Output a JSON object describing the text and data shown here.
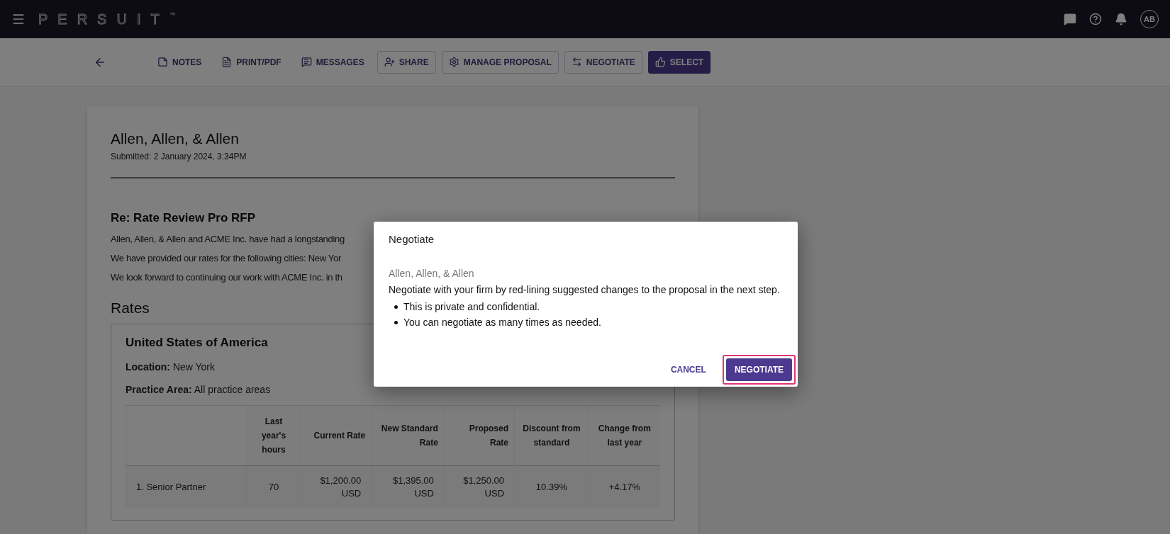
{
  "topbar": {
    "logo": "PERSUIT",
    "logo_mark": "™",
    "avatar": "AB"
  },
  "toolbar": {
    "buttons": [
      {
        "label": "NOTES",
        "kind": "text"
      },
      {
        "label": "PRINT/PDF",
        "kind": "text"
      },
      {
        "label": "MESSAGES",
        "kind": "text"
      },
      {
        "label": "SHARE",
        "kind": "outlined"
      },
      {
        "label": "MANAGE PROPOSAL",
        "kind": "outlined"
      },
      {
        "label": "NEGOTIATE",
        "kind": "outlined"
      },
      {
        "label": "SELECT",
        "kind": "contained"
      }
    ]
  },
  "proposal": {
    "firm": "Allen, Allen, & Allen",
    "submitted": "Submitted: 2 January 2024, 3:34PM",
    "subject": "Re: Rate Review Pro RFP",
    "paragraphs": [
      "Allen, Allen, & Allen and ACME Inc. have had a longstanding",
      "We have provided our rates for the following cities: New Yor",
      "We look forward to continuing our work with ACME Inc. in th"
    ],
    "rates_heading": "Rates",
    "region": {
      "title": "United States of America",
      "fields": [
        {
          "label": "Location:",
          "value": "New York"
        },
        {
          "label": "Practice Area:",
          "value": "All practice areas"
        }
      ],
      "table": {
        "columns": [
          "",
          "Last year's hours",
          "Current Rate",
          "New Standard Rate",
          "Proposed Rate",
          "Discount from standard",
          "Change from last year"
        ],
        "rows": [
          [
            "1. Senior Partner",
            "70",
            "$1,200.00 USD",
            "$1,395.00 USD",
            "$1,250.00 USD",
            "10.39%",
            "+4.17%"
          ]
        ]
      }
    }
  },
  "dialog": {
    "title": "Negotiate",
    "firm": "Allen, Allen, & Allen",
    "text": "Negotiate with your firm by red-lining suggested changes to the proposal in the next step.",
    "bullets": [
      "This is private and confidential.",
      "You can negotiate as many times as needed."
    ],
    "buttons": [
      {
        "label": "CANCEL",
        "kind": "text",
        "highlighted": false
      },
      {
        "label": "NEGOTIATE",
        "kind": "contained",
        "highlighted": true
      }
    ]
  }
}
